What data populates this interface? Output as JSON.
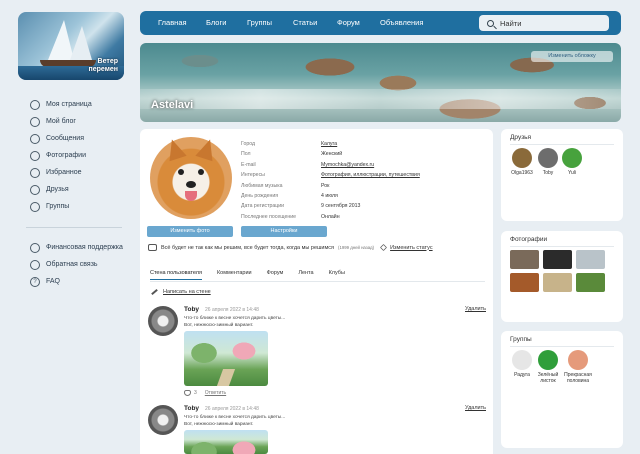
{
  "logo": {
    "text_line1": "Ветер",
    "text_line2": "перемен"
  },
  "left_nav": {
    "items": [
      {
        "label": "Моя страница",
        "icon": "user-icon"
      },
      {
        "label": "Мой блог",
        "icon": "blog-icon"
      },
      {
        "label": "Сообщения",
        "icon": "message-icon"
      },
      {
        "label": "Фотографии",
        "icon": "photo-icon"
      },
      {
        "label": "Избранное",
        "icon": "heart-icon"
      },
      {
        "label": "Друзья",
        "icon": "friends-icon"
      },
      {
        "label": "Группы",
        "icon": "groups-icon"
      }
    ],
    "bottom_items": [
      {
        "label": "Финансовая поддержка",
        "icon": "wallet-icon"
      },
      {
        "label": "Обратная связь",
        "icon": "feedback-icon"
      },
      {
        "label": "FAQ",
        "icon": "question-icon"
      }
    ]
  },
  "topnav": {
    "items": [
      "Главная",
      "Блоги",
      "Группы",
      "Статьи",
      "Форум",
      "Объявления"
    ],
    "search_value": "Найти"
  },
  "cover": {
    "username": "Astelavi",
    "change_cover": "Изменить обложку"
  },
  "profile": {
    "change_photo": "Изменить фото",
    "settings": "Настройки",
    "info": [
      {
        "key": "Город",
        "value": "Калуга",
        "link": true
      },
      {
        "key": "Пол",
        "value": "Женский",
        "link": false
      },
      {
        "key": "E-mail",
        "value": "Mymochka@yandex.ru",
        "link": true
      },
      {
        "key": "Интересы",
        "value": "Фотография, иллюстрации, путешествия",
        "link": true
      },
      {
        "key": "Любимая музыка",
        "value": "Рок",
        "link": false
      },
      {
        "key": "День рождения",
        "value": "4 июля",
        "link": false
      },
      {
        "key": "Дата регистрации",
        "value": "9 сентября 2013",
        "link": false
      },
      {
        "key": "Последнее посещение",
        "value": "Онлайн",
        "link": false
      }
    ],
    "status_text": "Всё будет не так как мы решим, все будет тогда, когда мы решимся",
    "status_when": "(1999 дней назад)",
    "change_status": "Изменить статус"
  },
  "tabs": [
    "Стена пользователя",
    "Комментарии",
    "Форум",
    "Лента",
    "Клубы"
  ],
  "write_on_wall": "Написать на стене",
  "posts": [
    {
      "author": "Toby",
      "date": "26 апреля 2022 в 14:48",
      "delete": "Удалить",
      "line1": "Что-то ближе к весне хочется дарить цветы...",
      "line2": "Вот, нежнюсю-зимный вариант.",
      "likes": "3",
      "reply": "Ответить"
    },
    {
      "author": "Toby",
      "date": "26 апреля 2022 в 14:48",
      "delete": "Удалить",
      "line1": "Что-то ближе к весне хочется дарить цветы...",
      "line2": "Вот, нежнюсю-зимный вариант."
    }
  ],
  "friends": {
    "title": "Друзья",
    "items": [
      {
        "name": "Olga1963",
        "color": "#8a6a3a"
      },
      {
        "name": "Toby",
        "color": "#6d6d6d"
      },
      {
        "name": "Yuli",
        "color": "#47a23d"
      }
    ]
  },
  "photos": {
    "title": "Фотографии",
    "colors": [
      "#7a6a5a",
      "#2b2b2b",
      "#b9c3c9",
      "#a45a2a",
      "#c7b38a",
      "#5a8a3a"
    ]
  },
  "groups": {
    "title": "Группы",
    "items": [
      {
        "name_line1": "Радуга",
        "name_line2": "",
        "color": "#e6e6e6"
      },
      {
        "name_line1": "Зелёный",
        "name_line2": "листок",
        "color": "#2f9e3a"
      },
      {
        "name_line1": "Прекрасная",
        "name_line2": "половина",
        "color": "#e59a7b"
      }
    ]
  }
}
